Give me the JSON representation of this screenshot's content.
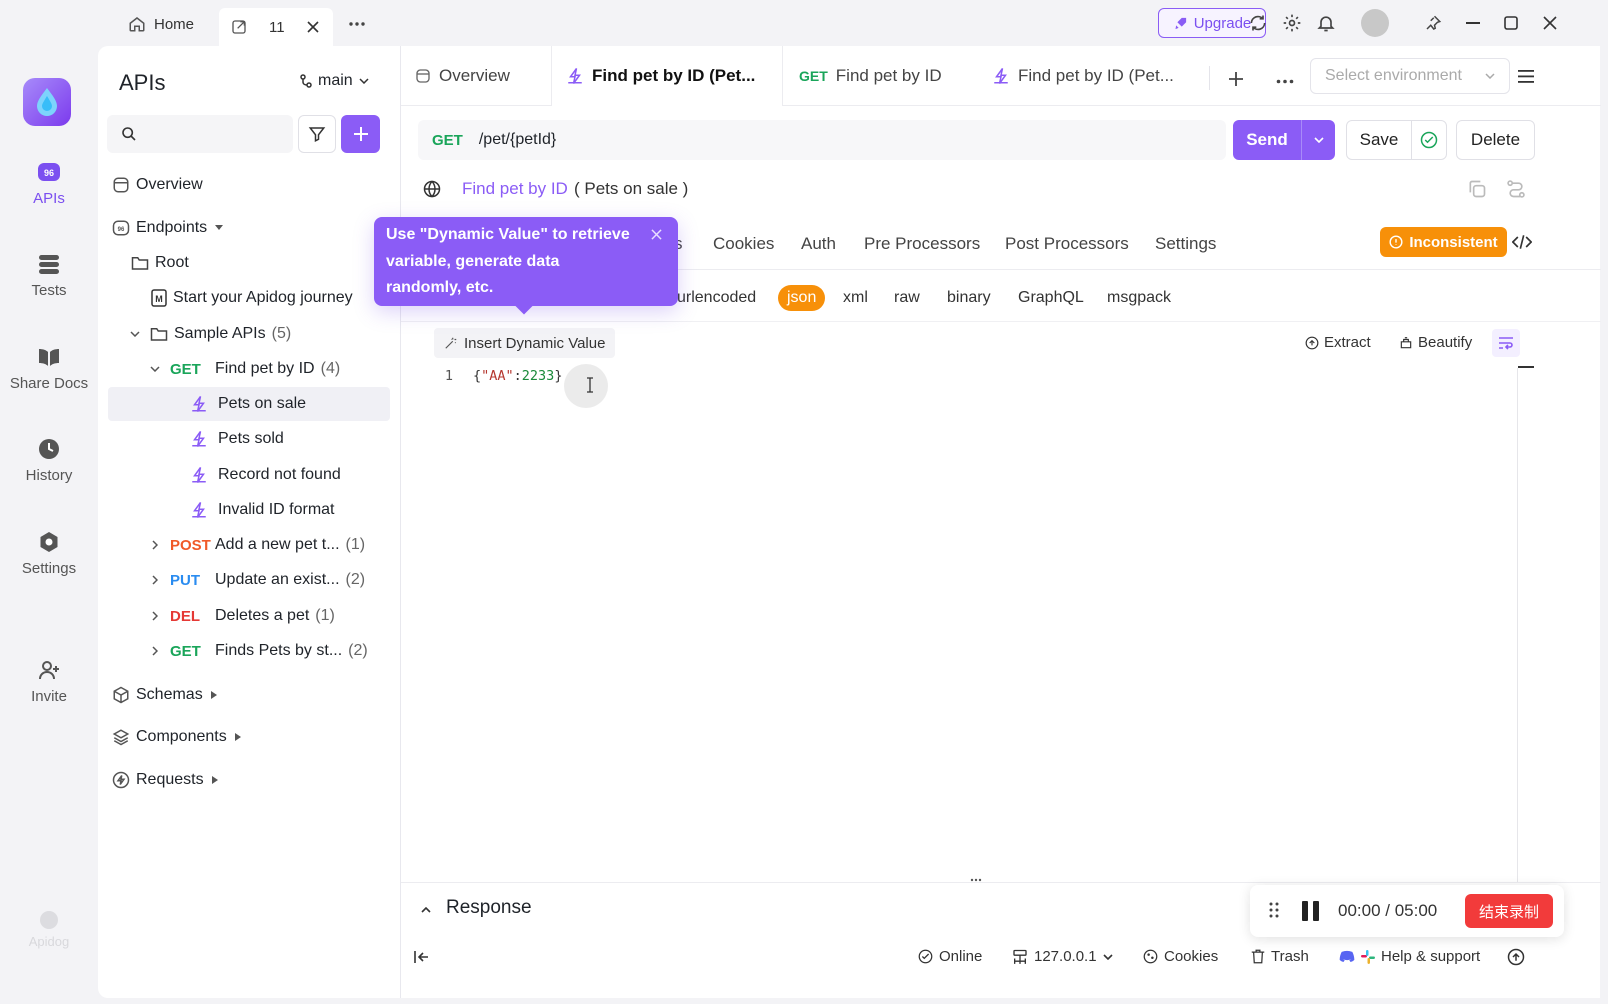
{
  "titlebar": {
    "home_label": "Home",
    "tab_count": "11",
    "upgrade_label": "Upgrade"
  },
  "rail": {
    "items": [
      {
        "label": "APIs",
        "icon": "apis-icon",
        "active": true
      },
      {
        "label": "Tests",
        "icon": "tests-icon"
      },
      {
        "label": "Share Docs",
        "icon": "book-icon"
      },
      {
        "label": "History",
        "icon": "clock-icon"
      },
      {
        "label": "Settings",
        "icon": "gear-icon"
      },
      {
        "label": "Invite",
        "icon": "add-user-icon"
      }
    ],
    "brand": "Apidog"
  },
  "sidebar": {
    "title": "APIs",
    "branch": "main",
    "search_placeholder": "",
    "tree": [
      {
        "label": "Overview"
      },
      {
        "label": "Endpoints"
      },
      {
        "label": "Root"
      },
      {
        "label": "Start your Apidog journey"
      },
      {
        "label": "Sample APIs",
        "count": "(5)"
      },
      {
        "method": "GET",
        "label": "Find pet by ID",
        "count": "(4)"
      },
      {
        "label": "Pets on sale"
      },
      {
        "label": "Pets sold"
      },
      {
        "label": "Record not found"
      },
      {
        "label": "Invalid ID format"
      },
      {
        "method": "POST",
        "label": "Add a new pet t...",
        "count": "(1)"
      },
      {
        "method": "PUT",
        "label": "Update an exist...",
        "count": "(2)"
      },
      {
        "method": "DEL",
        "label": "Deletes a pet",
        "count": "(1)"
      },
      {
        "method": "GET",
        "label": "Finds Pets by st...",
        "count": "(2)"
      },
      {
        "label": "Schemas"
      },
      {
        "label": "Components"
      },
      {
        "label": "Requests"
      }
    ]
  },
  "tabs": [
    {
      "label": "Overview"
    },
    {
      "label": "Find pet by ID (Pet..."
    },
    {
      "method": "GET",
      "label": "Find pet by ID"
    },
    {
      "label": "Find pet by ID (Pet..."
    }
  ],
  "environment_placeholder": "Select environment",
  "request": {
    "method": "GET",
    "path": "/pet/{petId}",
    "send_label": "Send",
    "save_label": "Save",
    "delete_label": "Delete",
    "name": "Find pet by ID",
    "case": "( Pets on sale )"
  },
  "subtabs": [
    "s",
    "Cookies",
    "Auth",
    "Pre Processors",
    "Post Processors",
    "Settings"
  ],
  "badge_inconsistent": "Inconsistent",
  "body_types": [
    "urlencoded",
    "json",
    "xml",
    "raw",
    "binary",
    "GraphQL",
    "msgpack"
  ],
  "tooltip": "Use \"Dynamic Value\" to retrieve variable, generate data randomly, etc.",
  "editor": {
    "insert_label": "Insert Dynamic Value",
    "extract_label": "Extract",
    "beautify_label": "Beautify",
    "line_number": "1",
    "code_open": "{",
    "code_key": "\"AA\"",
    "code_colon": ":",
    "code_value": "2233",
    "code_close": "}"
  },
  "response_label": "Response",
  "statusbar": {
    "online": "Online",
    "host": "127.0.0.1",
    "cookies": "Cookies",
    "trash": "Trash",
    "help": "Help & support"
  },
  "recorder": {
    "time": "00:00 / 05:00",
    "stop_label": "结束录制"
  },
  "colors": {
    "accent": "#8b5cf6",
    "warning": "#f79009",
    "get": "#1aa55a",
    "post": "#f05a28",
    "put": "#2a8cf0",
    "del": "#e53935"
  }
}
